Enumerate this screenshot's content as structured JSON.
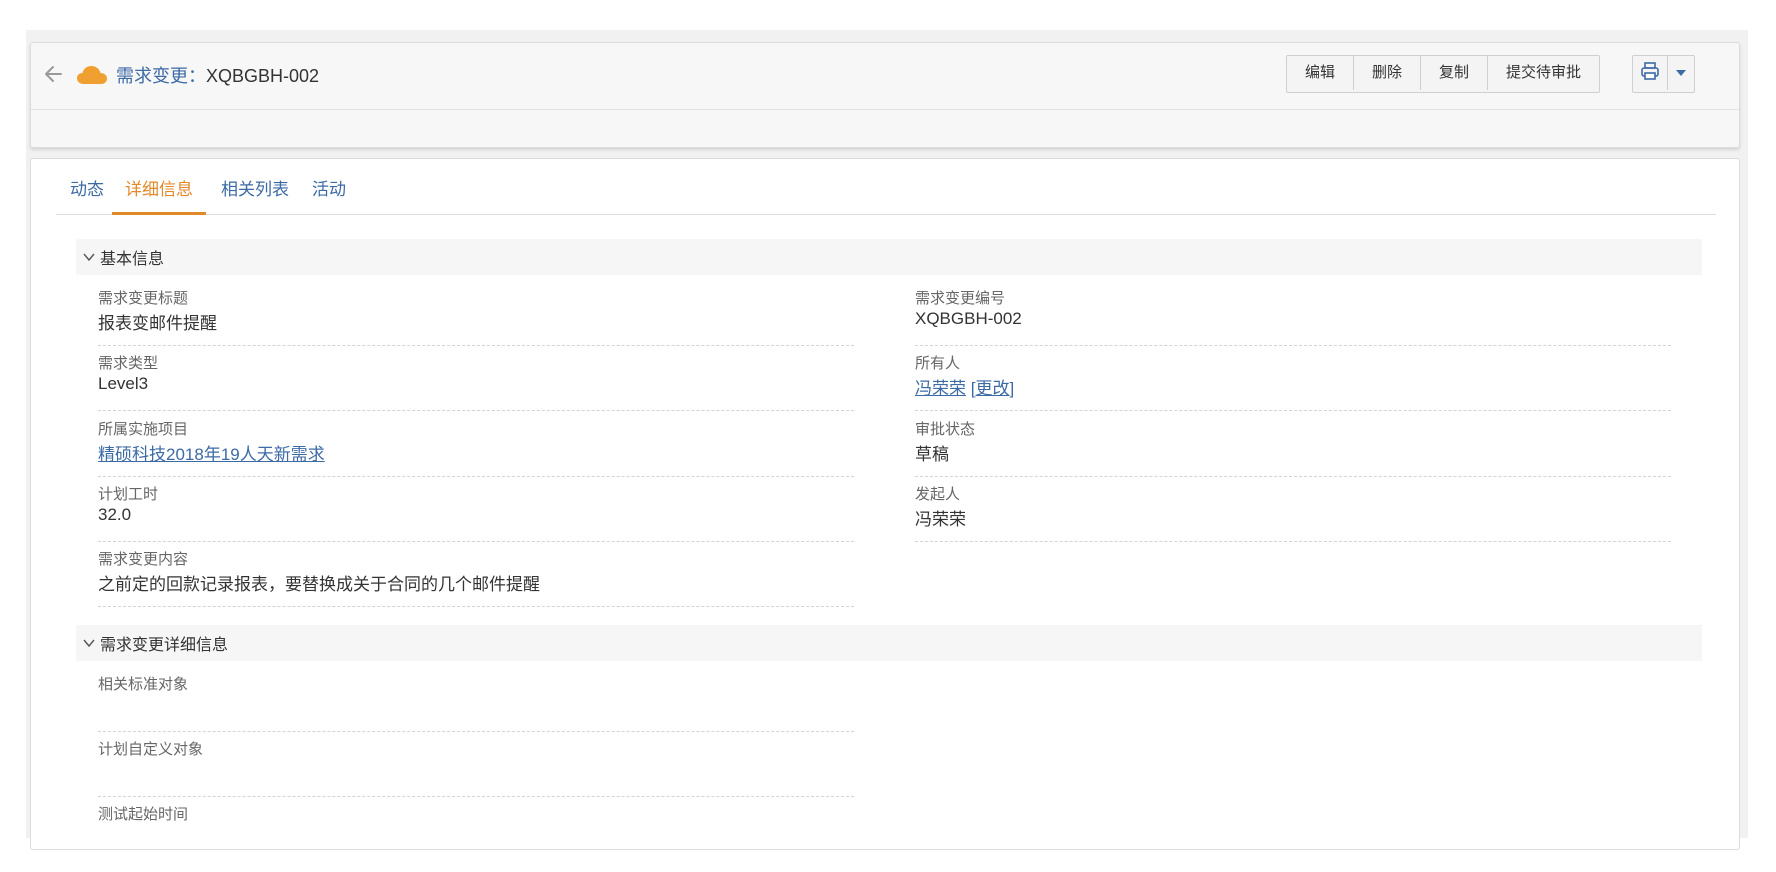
{
  "header": {
    "title_label": "需求变更",
    "title_sep": "：",
    "title_value": "XQBGBH-002",
    "buttons": [
      "编辑",
      "删除",
      "复制",
      "提交待审批"
    ],
    "icons": {
      "back": "arrow-left-icon",
      "object": "cloud-icon",
      "print": "printer-icon",
      "menu": "caret-down-icon"
    },
    "colors": {
      "cloud": "#f0a030",
      "link": "#3c6aa5",
      "tab_active": "#e2892a"
    }
  },
  "tabs": [
    "动态",
    "详细信息",
    "相关列表",
    "活动"
  ],
  "active_tab": "详细信息",
  "sections": {
    "basic": {
      "title": "基本信息",
      "fields": {
        "title": {
          "label": "需求变更标题",
          "value": "报表变邮件提醒"
        },
        "number": {
          "label": "需求变更编号",
          "value": "XQBGBH-002"
        },
        "type": {
          "label": "需求类型",
          "value": "Level3"
        },
        "owner": {
          "label": "所有人",
          "value": "冯荣荣",
          "change_open": "[",
          "change_label": "更改",
          "change_close": "]"
        },
        "project": {
          "label": "所属实施项目",
          "value": "精硕科技2018年19人天新需求"
        },
        "approval": {
          "label": "审批状态",
          "value": "草稿"
        },
        "hours": {
          "label": "计划工时",
          "value": "32.0"
        },
        "initiator": {
          "label": "发起人",
          "value": "冯荣荣"
        },
        "content": {
          "label": "需求变更内容",
          "value": "之前定的回款记录报表，要替换成关于合同的几个邮件提醒"
        }
      }
    },
    "detail": {
      "title": "需求变更详细信息",
      "fields": {
        "std_obj": {
          "label": "相关标准对象",
          "value": ""
        },
        "custom_obj": {
          "label": "计划自定义对象",
          "value": ""
        },
        "test_start": {
          "label": "测试起始时间",
          "value": ""
        }
      }
    }
  }
}
